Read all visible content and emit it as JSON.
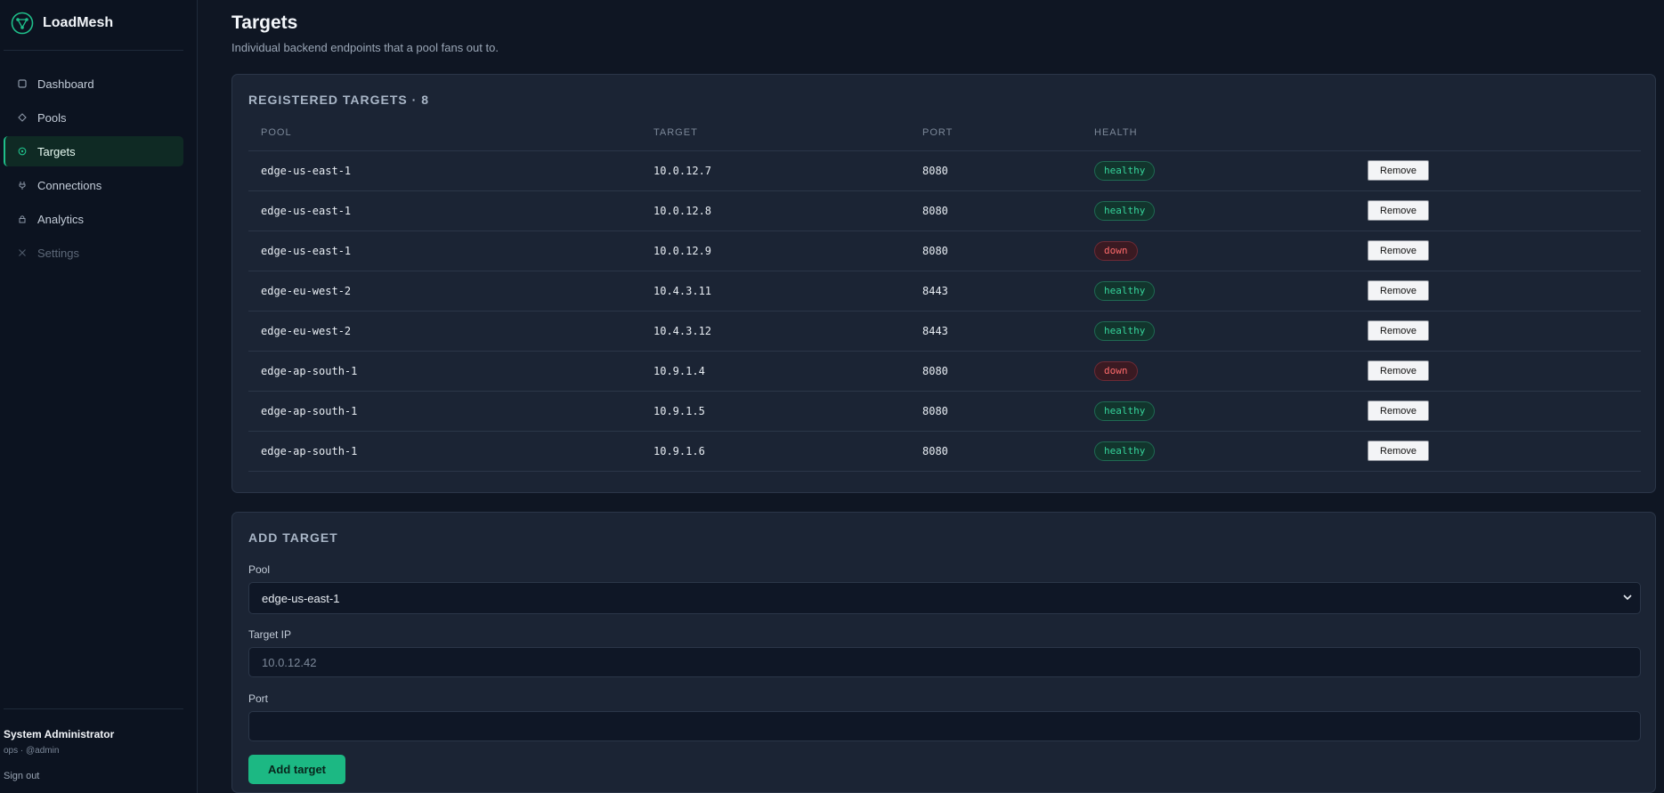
{
  "app": {
    "name": "LoadMesh"
  },
  "sidebar": {
    "items": [
      {
        "label": "Dashboard",
        "icon": "square-icon",
        "state": "normal"
      },
      {
        "label": "Pools",
        "icon": "diamond-icon",
        "state": "normal"
      },
      {
        "label": "Targets",
        "icon": "target-icon",
        "state": "active"
      },
      {
        "label": "Connections",
        "icon": "plug-icon",
        "state": "normal"
      },
      {
        "label": "Analytics",
        "icon": "lock-icon",
        "state": "normal"
      },
      {
        "label": "Settings",
        "icon": "tools-icon",
        "state": "disabled"
      }
    ],
    "user": {
      "name": "System Administrator",
      "meta": "ops · @admin"
    },
    "signout_label": "Sign out"
  },
  "page": {
    "title": "Targets",
    "subtitle": "Individual backend endpoints that a pool fans out to."
  },
  "targets_card": {
    "heading": "REGISTERED TARGETS · 8",
    "columns": [
      "POOL",
      "TARGET",
      "PORT",
      "HEALTH"
    ],
    "remove_label": "Remove",
    "rows": [
      {
        "pool": "edge-us-east-1",
        "target": "10.0.12.7",
        "port": "8080",
        "health": "healthy"
      },
      {
        "pool": "edge-us-east-1",
        "target": "10.0.12.8",
        "port": "8080",
        "health": "healthy"
      },
      {
        "pool": "edge-us-east-1",
        "target": "10.0.12.9",
        "port": "8080",
        "health": "down"
      },
      {
        "pool": "edge-eu-west-2",
        "target": "10.4.3.11",
        "port": "8443",
        "health": "healthy"
      },
      {
        "pool": "edge-eu-west-2",
        "target": "10.4.3.12",
        "port": "8443",
        "health": "healthy"
      },
      {
        "pool": "edge-ap-south-1",
        "target": "10.9.1.4",
        "port": "8080",
        "health": "down"
      },
      {
        "pool": "edge-ap-south-1",
        "target": "10.9.1.5",
        "port": "8080",
        "health": "healthy"
      },
      {
        "pool": "edge-ap-south-1",
        "target": "10.9.1.6",
        "port": "8080",
        "health": "healthy"
      }
    ]
  },
  "add_card": {
    "heading": "ADD TARGET",
    "pool_label": "Pool",
    "pool_value": "edge-us-east-1",
    "ip_label": "Target IP",
    "ip_placeholder": "10.0.12.42",
    "port_label": "Port",
    "port_value": "",
    "submit_label": "Add target"
  },
  "colors": {
    "accent": "#1cb883",
    "healthy": "#35d49b",
    "down": "#ff6b6b",
    "background": "#0f1623",
    "card": "#1b2434"
  }
}
